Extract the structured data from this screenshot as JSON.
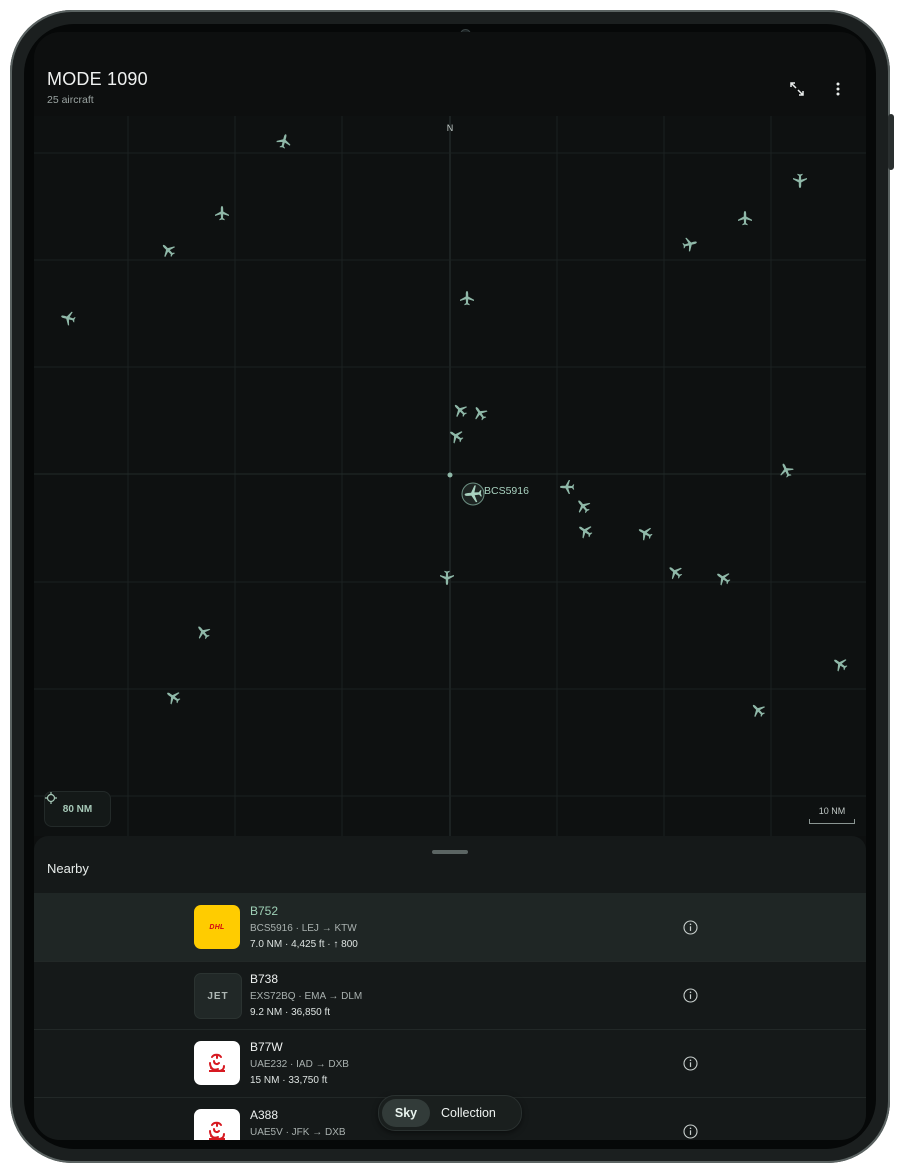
{
  "app": {
    "title": "MODE 1090",
    "subtitle": "25 aircraft"
  },
  "map": {
    "north_label": "N",
    "radius_label": "80 NM",
    "scale_label": "10 NM",
    "selected_callsign": "BCS5916",
    "plane_color": "#8fb8a8",
    "grid_color": "#1b2121"
  },
  "sheet": {
    "title": "Nearby",
    "rows": [
      {
        "logo_text": "DHL",
        "logo_kind": "dhl",
        "type": "B752",
        "route": "BCS5916 · LEJ → KTW",
        "stats": "7.0 NM · 4,425 ft · ↑ 800",
        "selected": true
      },
      {
        "logo_text": "JET",
        "logo_kind": "jet",
        "type": "B738",
        "route": "EXS72BQ · EMA → DLM",
        "stats": "9.2 NM · 36,850 ft",
        "selected": false
      },
      {
        "logo_text": "",
        "logo_kind": "emirates",
        "type": "B77W",
        "route": "UAE232 · IAD → DXB",
        "stats": "15 NM · 33,750 ft",
        "selected": false
      },
      {
        "logo_text": "",
        "logo_kind": "emirates",
        "type": "A388",
        "route": "UAE5V · JFK → DXB",
        "stats": "",
        "selected": false
      }
    ]
  },
  "nav": {
    "sky": "Sky",
    "collection": "Collection"
  }
}
